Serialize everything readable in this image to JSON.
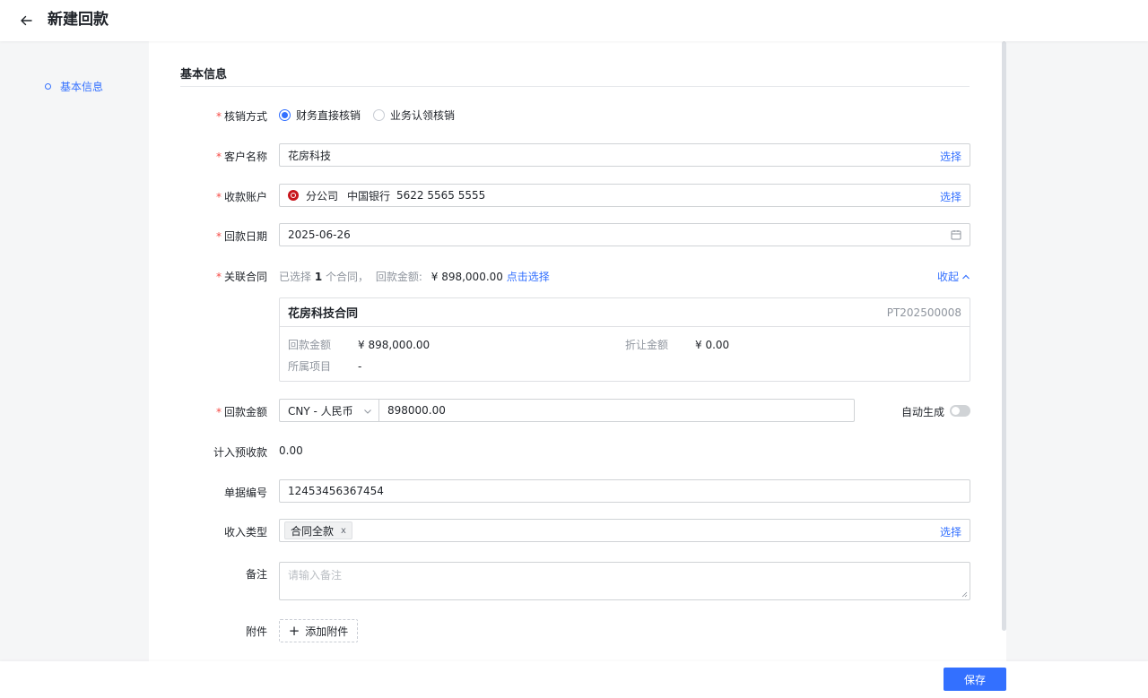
{
  "header": {
    "title": "新建回款"
  },
  "nav": {
    "items": [
      {
        "label": "基本信息"
      }
    ]
  },
  "section": {
    "title": "基本信息"
  },
  "form": {
    "write_off": {
      "label": "核销方式",
      "options": [
        {
          "label": "财务直接核销",
          "checked": true
        },
        {
          "label": "业务认领核销",
          "checked": false
        }
      ]
    },
    "customer": {
      "label": "客户名称",
      "value": "花房科技",
      "action": "选择"
    },
    "account": {
      "label": "收款账户",
      "branch": "分公司",
      "bank": "中国银行",
      "number": "5622 5565 5555",
      "action": "选择"
    },
    "date": {
      "label": "回款日期",
      "value": "2025-06-26"
    },
    "contract": {
      "label": "关联合同",
      "summary_prefix": "已选择",
      "count": "1",
      "summary_mid": "个合同，",
      "amount_label": "回款金额:",
      "amount": "¥ 898,000.00",
      "select_link": "点击选择",
      "collapse": "收起",
      "card": {
        "name": "花房科技合同",
        "code": "PT202500008",
        "payment_label": "回款金额",
        "payment_value": "¥ 898,000.00",
        "discount_label": "折让金额",
        "discount_value": "¥ 0.00",
        "project_label": "所属项目",
        "project_value": "-"
      }
    },
    "amount": {
      "label": "回款金额",
      "currency": "CNY - 人民币",
      "value": "898000.00",
      "auto_label": "自动生成"
    },
    "prepaid": {
      "label": "计入预收款",
      "value": "0.00"
    },
    "doc_number": {
      "label": "单据编号",
      "value": "12453456367454"
    },
    "income_type": {
      "label": "收入类型",
      "tag": "合同全款",
      "tag_close": "x",
      "action": "选择"
    },
    "remark": {
      "label": "备注",
      "placeholder": "请输入备注"
    },
    "attachment": {
      "label": "附件",
      "button": "添加附件"
    }
  },
  "footer": {
    "save": "保存"
  },
  "colors": {
    "primary": "#3370ff",
    "required": "#f54a45",
    "bank": "#c8161d"
  }
}
